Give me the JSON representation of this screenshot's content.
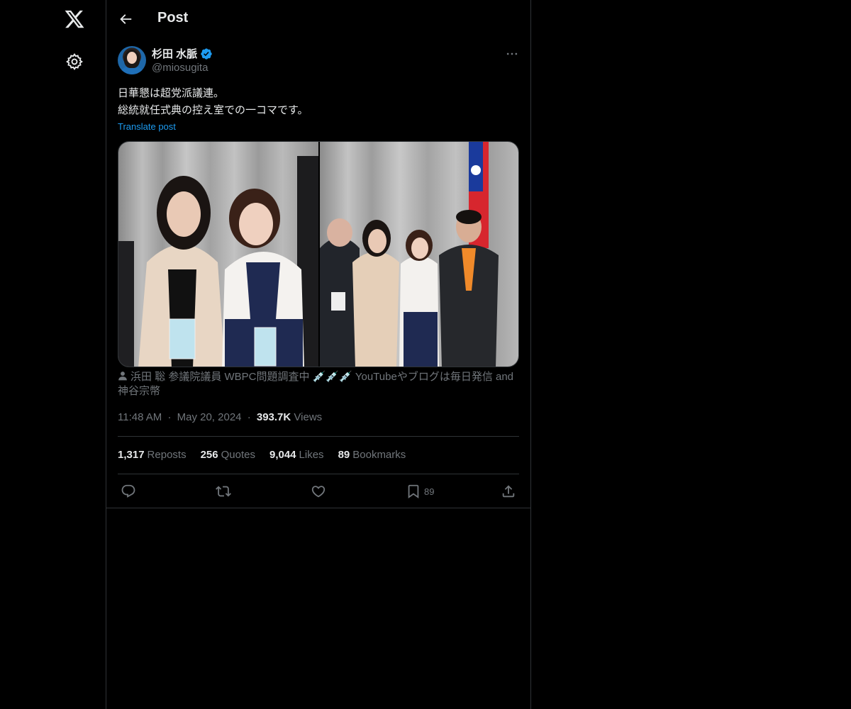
{
  "header": {
    "title": "Post"
  },
  "author": {
    "name": "杉田 水脈",
    "handle": "@miosugita"
  },
  "post": {
    "lines": [
      "日華懇は超党派議連。",
      "総統就任式典の控え室での一コマです。"
    ],
    "translate_label": "Translate post",
    "tagged_text": "浜田 聡 参議院議員 WBPC問題調査中 💉💉💉 YouTubeやブログは毎日発信 and 神谷宗幣",
    "time": "11:48 AM",
    "dot": "·",
    "date": "May 20, 2024",
    "views_count": "393.7K",
    "views_label": "Views"
  },
  "stats": [
    {
      "count": "1,317",
      "label": "Reposts"
    },
    {
      "count": "256",
      "label": "Quotes"
    },
    {
      "count": "9,044",
      "label": "Likes"
    },
    {
      "count": "89",
      "label": "Bookmarks"
    }
  ],
  "actions": {
    "icons": [
      "reply-icon",
      "repost-icon",
      "like-icon",
      "bookmark-icon",
      "share-icon"
    ],
    "bookmark_count": "89"
  },
  "colors": {
    "background": "#000000",
    "text": "#e7e9ea",
    "secondary": "#71767b",
    "accent": "#1d9bf0",
    "border": "#2f3336"
  }
}
